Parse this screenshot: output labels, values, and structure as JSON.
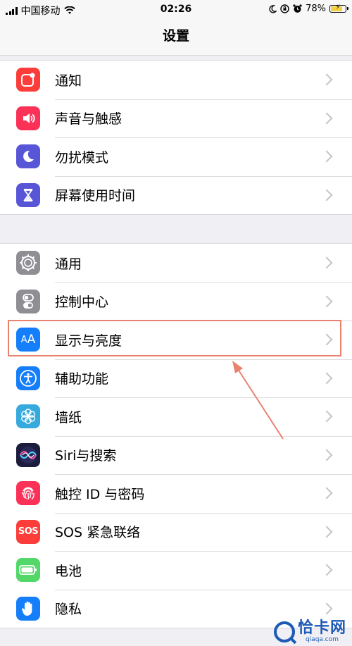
{
  "status_bar": {
    "carrier": "中国移动",
    "time": "02:26",
    "battery_percent": "78%",
    "battery_level": 0.78
  },
  "nav": {
    "title": "设置"
  },
  "groups": [
    {
      "items": [
        {
          "label": "通知",
          "icon": "notifications-icon",
          "color": "#fc3d39"
        },
        {
          "label": "声音与触感",
          "icon": "sound-icon",
          "color": "#fc3158"
        },
        {
          "label": "勿扰模式",
          "icon": "moon-icon",
          "color": "#5856d6"
        },
        {
          "label": "屏幕使用时间",
          "icon": "hourglass-icon",
          "color": "#5856d6"
        }
      ]
    },
    {
      "items": [
        {
          "label": "通用",
          "icon": "gear-icon",
          "color": "#8e8e93"
        },
        {
          "label": "控制中心",
          "icon": "toggles-icon",
          "color": "#8e8e93"
        },
        {
          "label": "显示与亮度",
          "icon": "text-size-icon",
          "color": "#147efb"
        },
        {
          "label": "辅助功能",
          "icon": "accessibility-icon",
          "color": "#147efb"
        },
        {
          "label": "墙纸",
          "icon": "flower-icon",
          "color": "#36aadc"
        },
        {
          "label": "Siri与搜索",
          "icon": "siri-icon",
          "color": "#1c1c3c"
        },
        {
          "label": "触控 ID 与密码",
          "icon": "fingerprint-icon",
          "color": "#fc3158"
        },
        {
          "label": "SOS 紧急联络",
          "icon": "sos-icon",
          "color": "#fc3d39"
        },
        {
          "label": "电池",
          "icon": "battery-icon",
          "color": "#53d769"
        },
        {
          "label": "隐私",
          "icon": "hand-icon",
          "color": "#147efb"
        }
      ]
    }
  ],
  "highlight_color": "#e8826e",
  "watermark": {
    "main": "恰卡网",
    "sub": "qiaqa.com"
  }
}
